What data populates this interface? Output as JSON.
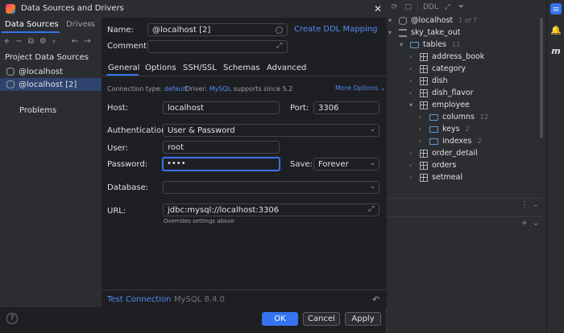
{
  "dialog": {
    "title": "Data Sources and Drivers",
    "close_icon": "close-icon",
    "app_icon": "datagrip-logo-icon"
  },
  "left": {
    "tabs": [
      "Data Sources",
      "Drivers"
    ],
    "more_icon": "chevron-down-icon",
    "toolbar_icons": [
      "add-icon",
      "remove-icon",
      "duplicate-icon",
      "settings-icon",
      "navigate-icon",
      "back-icon",
      "forward-icon"
    ],
    "section_title": "Project Data Sources",
    "items": [
      "@localhost",
      "@localhost [2]"
    ],
    "problems": "Problems",
    "help": "?"
  },
  "form": {
    "name_label": "Name:",
    "name_value": "@localhost [2]",
    "ddl_link": "Create DDL Mapping",
    "comment_label": "Comment:",
    "comment_value": "",
    "tabs": [
      "General",
      "Options",
      "SSH/SSL",
      "Schemas",
      "Advanced"
    ],
    "connection_type_label": "Connection type:",
    "connection_type_value": "default",
    "driver_label": "Driver:",
    "driver_value": "MySQL",
    "driver_note": "supports since 5.2",
    "more_options": "More Options",
    "host_label": "Host:",
    "host_value": "localhost",
    "port_label": "Port:",
    "port_value": "3306",
    "auth_label": "Authentication:",
    "auth_value": "User & Password",
    "user_label": "User:",
    "user_value": "root",
    "password_label": "Password:",
    "password_value": "••••",
    "save_label": "Save:",
    "save_value": "Forever",
    "database_label": "Database:",
    "database_value": "",
    "url_label": "URL:",
    "url_value": "jdbc:mysql://localhost:3306",
    "url_note": "Overrides settings above",
    "test_connection": "Test Connection",
    "server_version": "MySQL 8.4.0"
  },
  "buttons": {
    "ok": "OK",
    "cancel": "Cancel",
    "apply": "Apply"
  },
  "ide": {
    "toolbar_ddl": "DDL",
    "tree": [
      {
        "label": "@localhost",
        "count": "1 of 7",
        "icon": "database-icon",
        "expanded": true
      },
      {
        "label": "sky_take_out",
        "count": "",
        "icon": "schema-icon",
        "expanded": true
      },
      {
        "label": "tables",
        "count": "11",
        "icon": "folder-icon",
        "expanded": true
      },
      {
        "label": "address_book",
        "count": "",
        "icon": "table-icon",
        "expanded": false
      },
      {
        "label": "category",
        "count": "",
        "icon": "table-icon",
        "expanded": false
      },
      {
        "label": "dish",
        "count": "",
        "icon": "table-icon",
        "expanded": false
      },
      {
        "label": "dish_flavor",
        "count": "",
        "icon": "table-icon",
        "expanded": false
      },
      {
        "label": "employee",
        "count": "",
        "icon": "table-icon",
        "expanded": true
      },
      {
        "label": "columns",
        "count": "12",
        "icon": "folder-icon",
        "expanded": false
      },
      {
        "label": "keys",
        "count": "2",
        "icon": "folder-icon",
        "expanded": false
      },
      {
        "label": "indexes",
        "count": "2",
        "icon": "folder-icon",
        "expanded": false
      },
      {
        "label": "order_detail",
        "count": "",
        "icon": "table-icon",
        "expanded": false
      },
      {
        "label": "orders",
        "count": "",
        "icon": "table-icon",
        "expanded": false
      },
      {
        "label": "setmeal",
        "count": "",
        "icon": "table-icon",
        "expanded": false
      }
    ],
    "right_strip_label": "m"
  },
  "colors": {
    "accent": "#3574f0",
    "link": "#548af7",
    "selection": "#2e436e",
    "background": "#1e1f22",
    "panel": "#2b2d30"
  }
}
